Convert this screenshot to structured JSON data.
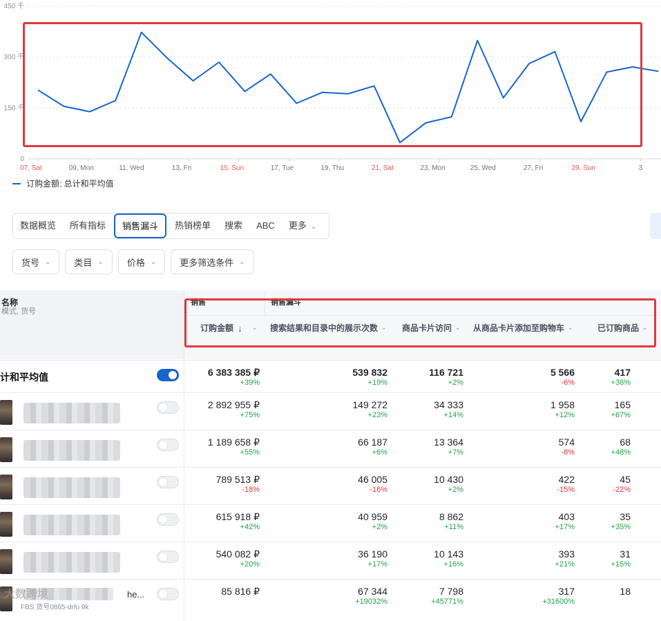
{
  "chart_data": {
    "type": "line",
    "ylim": [
      0,
      450
    ],
    "yticks": [
      "0",
      "150 千",
      "300 千",
      "450 千"
    ],
    "x_labels": [
      {
        "label": "07, Sat",
        "weekend": true
      },
      {
        "label": "09, Mon",
        "weekend": false
      },
      {
        "label": "11, Wed",
        "weekend": false
      },
      {
        "label": "13, Fri",
        "weekend": false
      },
      {
        "label": "15, Sun",
        "weekend": true
      },
      {
        "label": "17, Tue",
        "weekend": false
      },
      {
        "label": "19, Thu",
        "weekend": false
      },
      {
        "label": "21, Sat",
        "weekend": true
      },
      {
        "label": "23, Mon",
        "weekend": false
      },
      {
        "label": "25, Wed",
        "weekend": false
      },
      {
        "label": "27, Fri",
        "weekend": false
      },
      {
        "label": "29, Sun",
        "weekend": true
      },
      {
        "label": "3",
        "weekend": false
      }
    ],
    "series": [
      {
        "name": "订购金额: 总计和平均值",
        "color": "#1764cc",
        "values": [
          203,
          155,
          139,
          172,
          373,
          297,
          230,
          285,
          199,
          250,
          164,
          196,
          192,
          215,
          48,
          106,
          124,
          349,
          180,
          281,
          316,
          110,
          256,
          271,
          258
        ]
      }
    ]
  },
  "legend": {
    "label": "订购金额: 总计和平均值"
  },
  "tabs": [
    {
      "label": "数据概览",
      "active": false
    },
    {
      "label": "所有指标",
      "active": false
    },
    {
      "label": "销售漏斗",
      "active": true
    },
    {
      "label": "热销榜单",
      "active": false
    },
    {
      "label": "搜索",
      "active": false
    },
    {
      "label": "ABC",
      "active": false
    },
    {
      "label": "更多",
      "active": false,
      "dropdown": true
    }
  ],
  "filters": [
    {
      "label": "货号"
    },
    {
      "label": "类目"
    },
    {
      "label": "价格"
    },
    {
      "label": "更多筛选条件"
    }
  ],
  "table": {
    "name_header": "名称",
    "name_subheader": "模式, 货号",
    "groups": [
      {
        "label": "销售"
      },
      {
        "label": "销售漏斗"
      }
    ],
    "columns": [
      {
        "label": "订购金额",
        "sorted": true
      },
      {
        "label": "搜索结果和目录中的展示次数"
      },
      {
        "label": "商品卡片访问"
      },
      {
        "label": "从商品卡片添加至购物车"
      },
      {
        "label": "已订购商品"
      }
    ],
    "total_label": "计和平均值",
    "rows": [
      {
        "total": true,
        "toggle": true,
        "cells": [
          {
            "value": "6 383 385 ₽",
            "pct": "+39%",
            "dir": "pos"
          },
          {
            "value": "539 832",
            "pct": "+19%",
            "dir": "pos"
          },
          {
            "value": "116 721",
            "pct": "+2%",
            "dir": "pos"
          },
          {
            "value": "5 566",
            "pct": "-6%",
            "dir": "neg"
          },
          {
            "value": "417",
            "pct": "+36%",
            "dir": "pos"
          }
        ]
      },
      {
        "toggle": false,
        "cells": [
          {
            "value": "2 892 955 ₽",
            "pct": "+75%",
            "dir": "pos"
          },
          {
            "value": "149 272",
            "pct": "+23%",
            "dir": "pos"
          },
          {
            "value": "34 333",
            "pct": "+14%",
            "dir": "pos"
          },
          {
            "value": "1 958",
            "pct": "+12%",
            "dir": "pos"
          },
          {
            "value": "165",
            "pct": "+67%",
            "dir": "pos"
          }
        ]
      },
      {
        "toggle": false,
        "cells": [
          {
            "value": "1 189 658 ₽",
            "pct": "+55%",
            "dir": "pos"
          },
          {
            "value": "66 187",
            "pct": "+6%",
            "dir": "pos"
          },
          {
            "value": "13 364",
            "pct": "+7%",
            "dir": "pos"
          },
          {
            "value": "574",
            "pct": "-8%",
            "dir": "neg"
          },
          {
            "value": "68",
            "pct": "+48%",
            "dir": "pos"
          }
        ]
      },
      {
        "toggle": false,
        "cells": [
          {
            "value": "789 513 ₽",
            "pct": "-18%",
            "dir": "neg"
          },
          {
            "value": "46 005",
            "pct": "-16%",
            "dir": "neg"
          },
          {
            "value": "10 430",
            "pct": "+2%",
            "dir": "pos"
          },
          {
            "value": "422",
            "pct": "-15%",
            "dir": "neg"
          },
          {
            "value": "45",
            "pct": "-22%",
            "dir": "neg"
          }
        ]
      },
      {
        "toggle": false,
        "cells": [
          {
            "value": "615 918 ₽",
            "pct": "+42%",
            "dir": "pos"
          },
          {
            "value": "40 959",
            "pct": "+2%",
            "dir": "pos"
          },
          {
            "value": "8 862",
            "pct": "+11%",
            "dir": "pos"
          },
          {
            "value": "403",
            "pct": "+17%",
            "dir": "pos"
          },
          {
            "value": "35",
            "pct": "+35%",
            "dir": "pos"
          }
        ]
      },
      {
        "toggle": false,
        "cells": [
          {
            "value": "540 082 ₽",
            "pct": "+20%",
            "dir": "pos"
          },
          {
            "value": "36 190",
            "pct": "+17%",
            "dir": "pos"
          },
          {
            "value": "10 143",
            "pct": "+16%",
            "dir": "pos"
          },
          {
            "value": "393",
            "pct": "+21%",
            "dir": "pos"
          },
          {
            "value": "31",
            "pct": "+15%",
            "dir": "pos"
          }
        ]
      },
      {
        "toggle": false,
        "name_text": "he...",
        "sub_text": "FBS 货号0865-drfu 9k",
        "cells": [
          {
            "value": "85 816 ₽",
            "pct": "",
            "dir": "pos"
          },
          {
            "value": "67 344",
            "pct": "+19032%",
            "dir": "pos"
          },
          {
            "value": "7 798",
            "pct": "+45771%",
            "dir": "pos"
          },
          {
            "value": "317",
            "pct": "+31600%",
            "dir": "pos"
          },
          {
            "value": "18",
            "pct": "",
            "dir": "pos"
          }
        ]
      }
    ]
  },
  "watermark": "大数跨境"
}
